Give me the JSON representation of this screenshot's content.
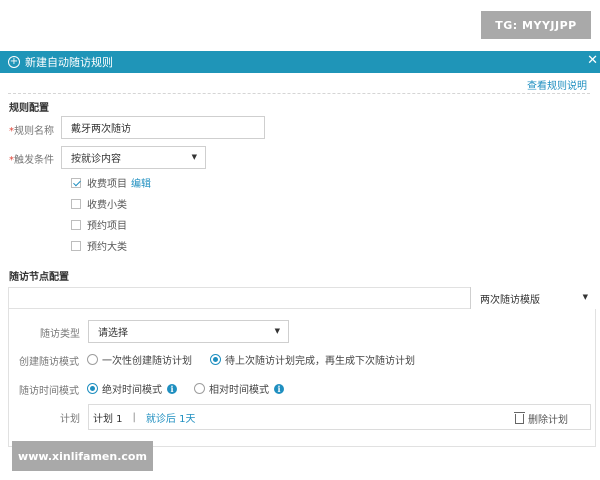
{
  "watermarks": {
    "top": "TG: MYYJJPP",
    "bottom": "www.xinlifamen.com"
  },
  "dialog": {
    "title": "新建自动随访规则",
    "close_glyph": "✕",
    "view_rules_link": "查看规则说明"
  },
  "rule_config": {
    "section_title": "规则配置",
    "name_label": "规则名称",
    "name_value": "戴牙两次随访",
    "trigger_label": "触发条件",
    "trigger_value": "按就诊内容",
    "options": [
      {
        "label": "收费项目",
        "checked": true,
        "action": "编辑"
      },
      {
        "label": "收费小类",
        "checked": false
      },
      {
        "label": "预约项目",
        "checked": false
      },
      {
        "label": "预约大类",
        "checked": false
      }
    ],
    "required_mark": "*"
  },
  "node_config": {
    "section_title": "随访节点配置",
    "template_value": "两次随访模版",
    "type_label": "随访类型",
    "type_placeholder": "请选择",
    "create_mode_label": "创建随访模式",
    "create_mode_options": [
      "一次性创建随访计划",
      "待上次随访计划完成，再生成下次随访计划"
    ],
    "create_mode_selected": 1,
    "time_mode_label": "随访时间模式",
    "time_mode_options": [
      "绝对时间模式",
      "相对时间模式"
    ],
    "time_mode_selected": 0,
    "plan_label": "计划",
    "plan_name": "计划 1",
    "plan_sep": "|",
    "plan_timing": "就诊后 1天",
    "delete_plan": "删除计划"
  },
  "colors": {
    "title_bar": "#1f95b8",
    "accent": "#1f8fc0",
    "required": "#e0463a"
  },
  "icons": [
    "plus-circle-icon",
    "close-icon",
    "check-icon",
    "caret-down-icon",
    "info-icon",
    "trash-icon"
  ]
}
